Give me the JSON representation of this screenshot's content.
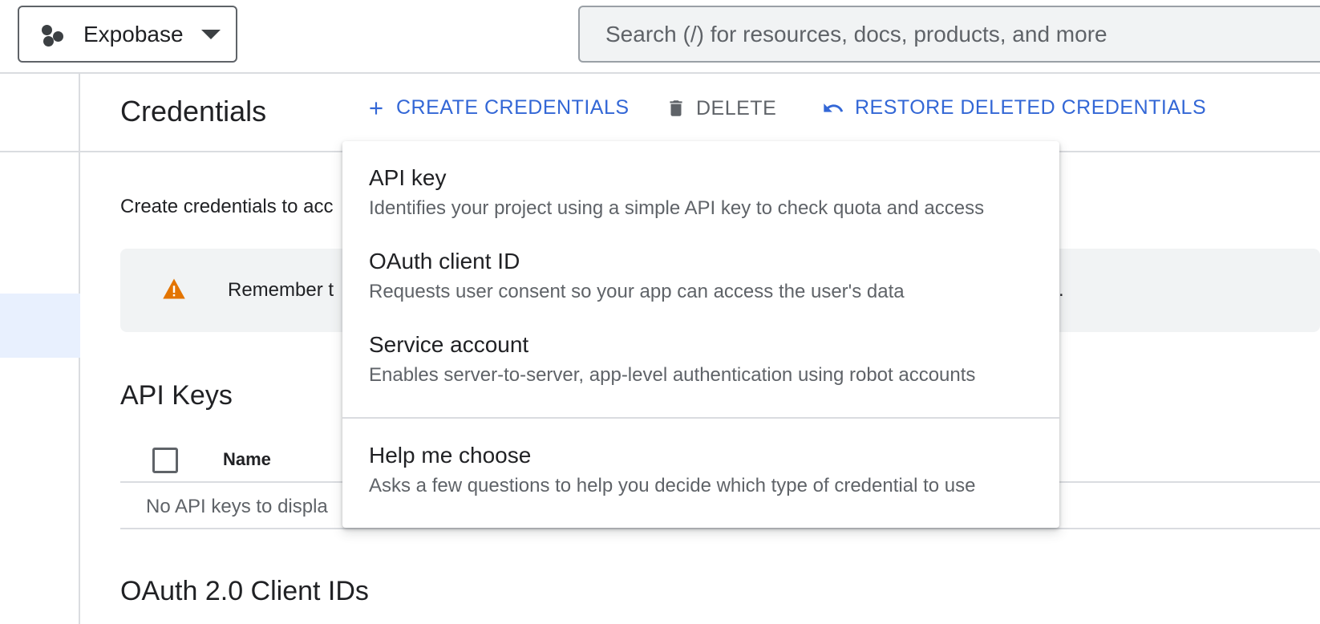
{
  "topbar": {
    "project_name": "Expobase",
    "search_placeholder": "Search (/) for resources, docs, products, and more"
  },
  "header": {
    "title": "Credentials",
    "create_label": "CREATE CREDENTIALS",
    "delete_label": "DELETE",
    "restore_label": "RESTORE DELETED CREDENTIALS"
  },
  "content": {
    "intro_text": "Create credentials to acc",
    "warning_text": "Remember t",
    "warning_tail": ".",
    "api_keys_title": "API Keys",
    "table": {
      "name_header": "Name",
      "empty_text": "No API keys to displa"
    },
    "oauth_title": "OAuth 2.0 Client IDs"
  },
  "menu": {
    "items": [
      {
        "title": "API key",
        "description": "Identifies your project using a simple API key to check quota and access"
      },
      {
        "title": "OAuth client ID",
        "description": "Requests user consent so your app can access the user's data"
      },
      {
        "title": "Service account",
        "description": "Enables server-to-server, app-level authentication using robot accounts"
      },
      {
        "title": "Help me choose",
        "description": "Asks a few questions to help you decide which type of credential to use"
      }
    ]
  },
  "colors": {
    "accent": "#3367d6",
    "warning": "#e37400",
    "muted": "#5f6368"
  }
}
